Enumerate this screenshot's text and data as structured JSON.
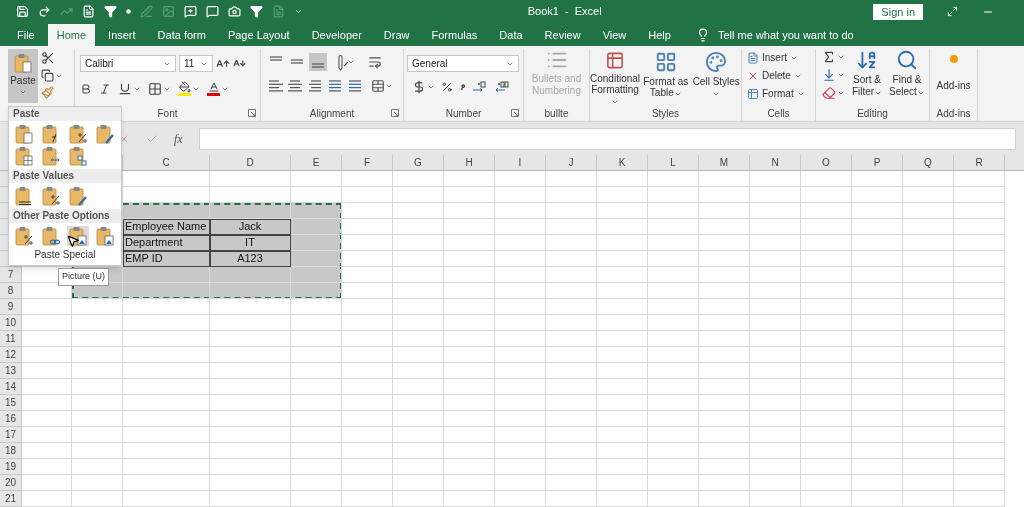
{
  "window": {
    "title": "Book1  -  Excel",
    "sign_in": "Sign in"
  },
  "quick_access": [
    {
      "disabled": false
    },
    {
      "disabled": false
    },
    {
      "disabled": true
    },
    {
      "disabled": false
    },
    {
      "disabled": false
    },
    {
      "disabled": false
    },
    {
      "disabled": true
    },
    {
      "disabled": true
    },
    {
      "disabled": false
    },
    {
      "disabled": false
    },
    {
      "disabled": false
    },
    {
      "disabled": false
    },
    {
      "disabled": true
    }
  ],
  "tabs": [
    {
      "label": "File",
      "selected": false
    },
    {
      "label": "Home",
      "selected": true
    },
    {
      "label": "Insert",
      "selected": false
    },
    {
      "label": "Data form",
      "selected": false
    },
    {
      "label": "Page Layout",
      "selected": false
    },
    {
      "label": "Developer",
      "selected": false
    },
    {
      "label": "Draw",
      "selected": false
    },
    {
      "label": "Formulas",
      "selected": false
    },
    {
      "label": "Data",
      "selected": false
    },
    {
      "label": "Review",
      "selected": false
    },
    {
      "label": "View",
      "selected": false
    },
    {
      "label": "Help",
      "selected": false
    }
  ],
  "tell_me": {
    "placeholder": "Tell me what you want to do"
  },
  "ribbon": {
    "paste": {
      "label": "Paste",
      "pressed": true
    },
    "font": {
      "name": "Calibri",
      "size": "11",
      "label": "Font"
    },
    "alignment": {
      "vertical": [
        {
          "selected": false
        },
        {
          "selected": false
        },
        {
          "selected": true
        }
      ],
      "label": "Alignment"
    },
    "number": {
      "format": "General",
      "label": "Number"
    },
    "bullets": {
      "button": "Bullets and Numbering",
      "disabled": true,
      "label": "bullte"
    },
    "styles": {
      "buttons": [
        "Conditional Formatting",
        "Format as Table",
        "Cell Styles"
      ],
      "label": "Styles"
    },
    "cells": {
      "buttons": [
        "Insert",
        "Delete",
        "Format"
      ],
      "label": "Cells"
    },
    "editing": {
      "buttons": [
        "Sort & Filter",
        "Find & Select"
      ],
      "label": "Editing"
    },
    "addins": {
      "button": "Add-ins",
      "label": "Add-ins"
    }
  },
  "formula_bar": {
    "function_label": "fx"
  },
  "sheet": {
    "columns": [
      "C",
      "D",
      "E",
      "F",
      "G",
      "H",
      "I",
      "J",
      "K",
      "L",
      "M",
      "N",
      "O",
      "P",
      "Q",
      "R"
    ],
    "rows": [
      "7",
      "8",
      "9",
      "10",
      "11",
      "12",
      "13",
      "14",
      "15",
      "16",
      "17",
      "18",
      "19",
      "20",
      "21"
    ],
    "table": [
      [
        "Employee Name",
        "Jack"
      ],
      [
        "Department",
        "IT"
      ],
      [
        "EMP ID",
        "A123"
      ]
    ],
    "copy_marquee": true
  },
  "paste_menu": {
    "sections": [
      {
        "title": "Paste",
        "options": [
          {
            "selected": false
          },
          {
            "selected": false
          },
          {
            "selected": false
          },
          {
            "selected": false
          },
          {
            "selected": false
          },
          {
            "selected": false
          },
          {
            "selected": false
          }
        ]
      },
      {
        "title": "Paste Values",
        "options": [
          {
            "selected": false
          },
          {
            "selected": false
          },
          {
            "selected": false
          }
        ]
      },
      {
        "title": "Other Paste Options",
        "options": [
          {
            "selected": false
          },
          {
            "selected": false
          },
          {
            "selected": true
          },
          {
            "selected": false
          }
        ]
      }
    ],
    "footer": "Paste Special",
    "tooltip": "Picture (U)"
  }
}
